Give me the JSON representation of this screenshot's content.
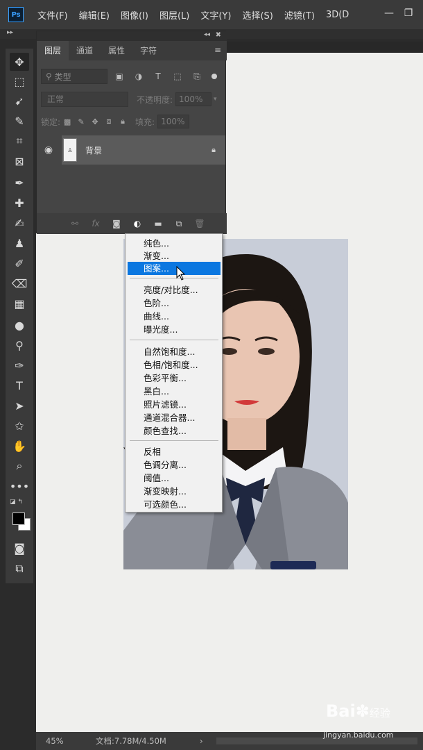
{
  "menubar": {
    "logo": "Ps",
    "items": [
      "文件(F)",
      "编辑(E)",
      "图像(I)",
      "图层(L)",
      "文字(Y)",
      "选择(S)",
      "滤镜(T)",
      "3D(D"
    ]
  },
  "layers_panel": {
    "tabs": [
      "图层",
      "通道",
      "属性",
      "字符"
    ],
    "filter_placeholder": "类型",
    "blend_mode": "正常",
    "opacity_label": "不透明度:",
    "opacity_value": "100%",
    "lock_label": "锁定:",
    "fill_label": "填充:",
    "fill_value": "100%",
    "layer": {
      "name": "背景"
    }
  },
  "adjustment_menu": {
    "group1": [
      "纯色...",
      "渐变...",
      "图案..."
    ],
    "highlighted": "图案...",
    "group2": [
      "亮度/对比度...",
      "色阶...",
      "曲线...",
      "曝光度..."
    ],
    "group3": [
      "自然饱和度...",
      "色相/饱和度...",
      "色彩平衡...",
      "黑白...",
      "照片滤镜...",
      "通道混合器...",
      "颜色查找..."
    ],
    "group4": [
      "反相",
      "色调分离...",
      "阈值...",
      "渐变映射...",
      "可选颜色..."
    ]
  },
  "statusbar": {
    "zoom": "45%",
    "doc_info": "文档:7.78M/4.50M"
  },
  "watermark": {
    "logo": "Bai",
    "logo_tail": "经验",
    "url": "jingyan.baidu.com"
  },
  "colors": {
    "accent": "#0b77e0",
    "foreground": "#000000",
    "background": "#ffffff"
  }
}
